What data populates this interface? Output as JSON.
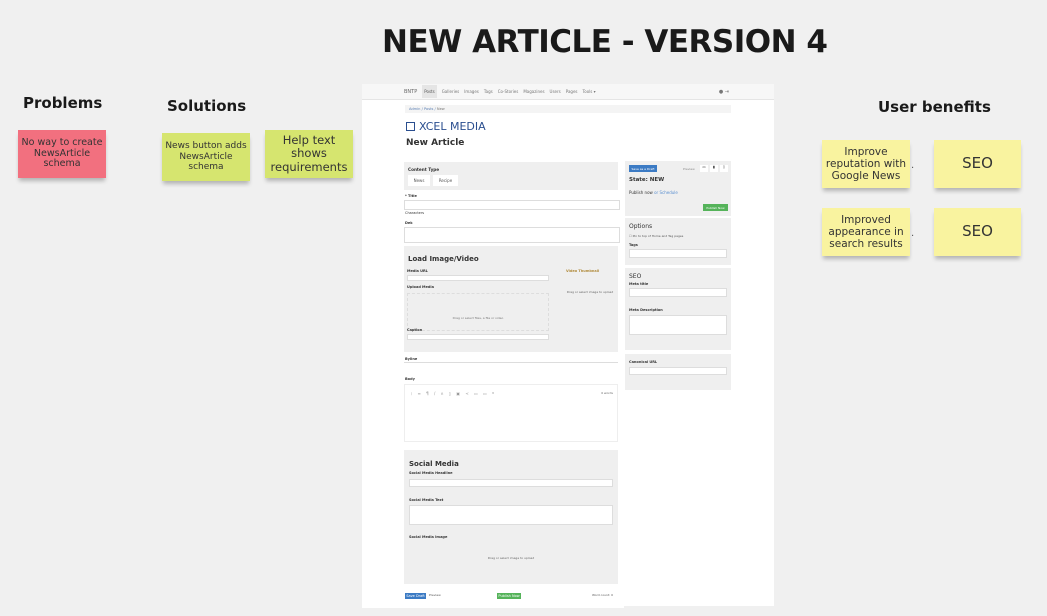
{
  "title": "NEW ARTICLE - VERSION 4",
  "columns": {
    "problems": {
      "heading": "Problems",
      "notes": [
        "No way to create NewsArticle schema"
      ]
    },
    "solutions": {
      "heading": "Solutions",
      "notes": [
        "News button adds NewsArticle schema",
        "Help text shows requirements"
      ]
    },
    "benefits": {
      "heading": "User benefits",
      "notes": [
        "Improve reputation with Google News",
        "SEO",
        "Improved appearance in search results",
        "SEO"
      ]
    }
  },
  "colors": {
    "problem": "#f2707f",
    "solution": "#d6e56f",
    "benefit": "#f9f39f"
  },
  "mockup": {
    "nav": {
      "brand": "BNTP",
      "items": [
        "Posts",
        "Galleries",
        "Images",
        "Tags",
        "Co-Stories",
        "Magazines",
        "Users",
        "Pages",
        "Tools ▾"
      ],
      "user_icon": "user-icon",
      "logout_icon": "logout-icon"
    },
    "breadcrumb": [
      "Admin",
      "Posts",
      "New"
    ],
    "logo": "XCEL MEDIA",
    "page_title": "New Article",
    "content_type": {
      "label": "Content Type",
      "buttons": [
        "News",
        "Recipe"
      ]
    },
    "fields": {
      "title": "* Title",
      "characters": "Characters",
      "dek": "Dek"
    },
    "media": {
      "heading": "Load Image/Video",
      "url_label": "Media URL",
      "upload_label": "Upload Media",
      "drop_text": "Drag or select files, a file or video",
      "caption_label": "Caption",
      "thumbnail_label": "Video Thumbnail",
      "thumb_drop": "Drag or select image to upload"
    },
    "byline": "Byline",
    "body": "Body",
    "body_words": "0 words",
    "social": {
      "heading": "Social Media",
      "headline_label": "Social Media Headline",
      "text_label": "Social Media Text",
      "image_label": "Social Media Image",
      "drop": "Drag or select image to upload"
    },
    "sidebar": {
      "save_draft": "Save as a Draft",
      "preview": "Preview",
      "state": "State: NEW",
      "publish_now": "Publish now",
      "or": "or",
      "schedule": "Schedule",
      "publish_btn": "Publish Now",
      "options_heading": "Options",
      "options_check": "Pin to top of Home and Tag pages",
      "tags_label": "Tags",
      "seo_heading": "SEO",
      "meta_title": "Meta title",
      "meta_desc": "Meta Description",
      "canonical": "Canonical URL"
    },
    "footer": {
      "save": "Save Draft",
      "preview": "Preview",
      "publish": "Publish Now",
      "word_count": "Word count: 0"
    }
  }
}
